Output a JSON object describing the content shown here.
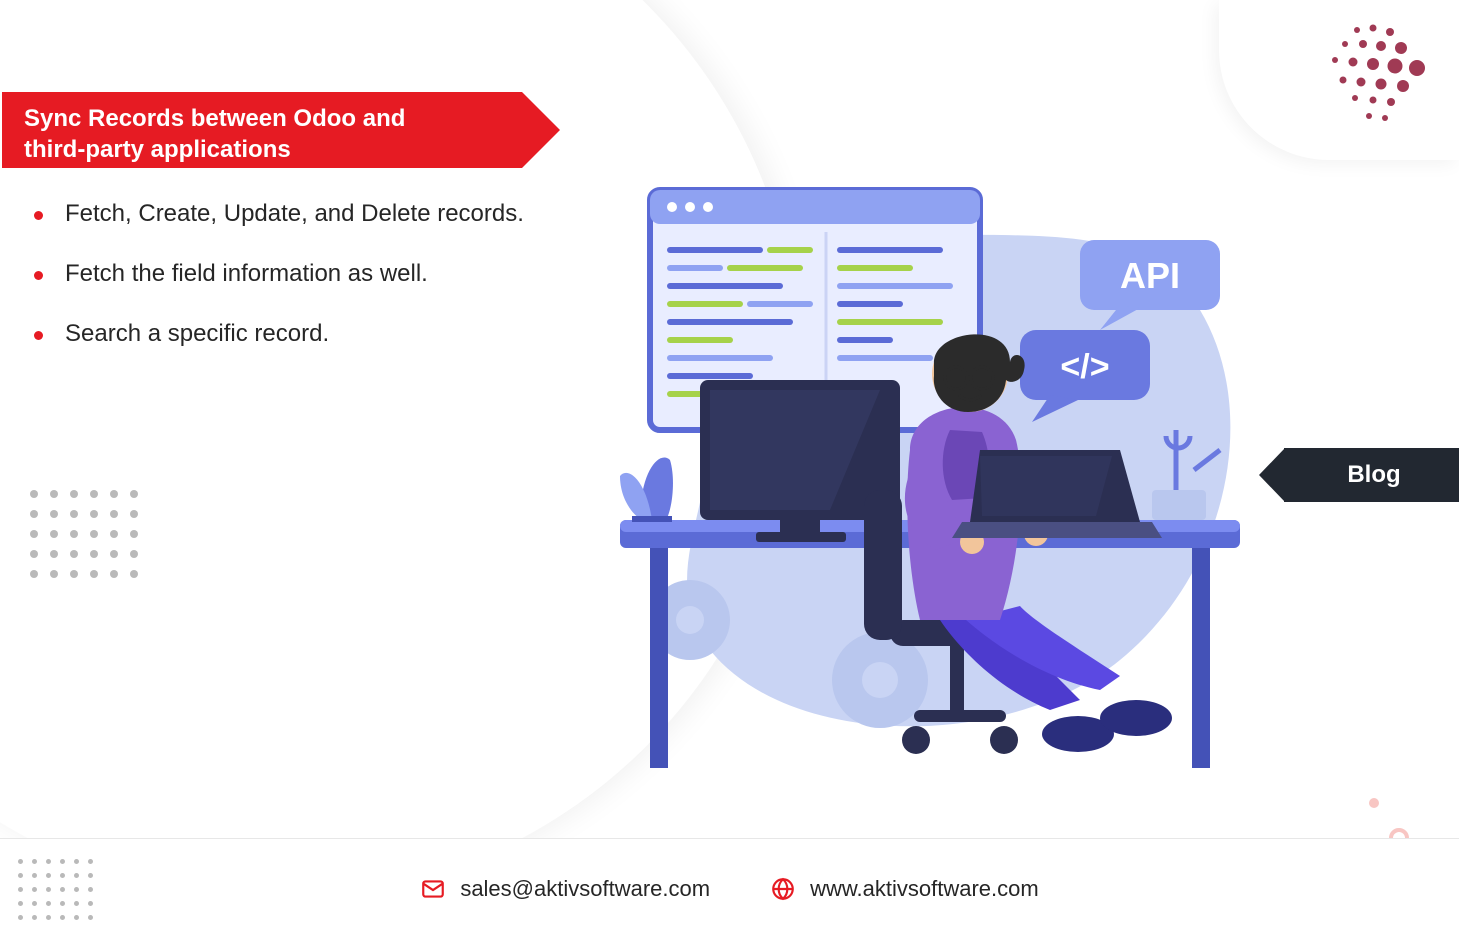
{
  "banner": {
    "title_line1": "Sync Records between Odoo and",
    "title_line2": "third-party applications"
  },
  "bullets": [
    "Fetch, Create, Update, and Delete records.",
    "Fetch the field information as well.",
    "Search a specific record."
  ],
  "badge": {
    "label": "Blog"
  },
  "illustration": {
    "api_label": "API",
    "code_label": "</>"
  },
  "footer": {
    "email": "sales@aktivsoftware.com",
    "website": "www.aktivsoftware.com"
  },
  "colors": {
    "brand_red": "#e61b23",
    "badge_dark": "#222831",
    "logo_accent": "#a03a54"
  }
}
